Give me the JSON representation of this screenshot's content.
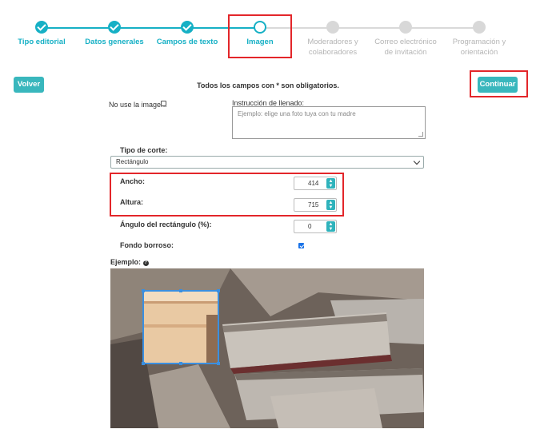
{
  "stepper": {
    "steps": [
      {
        "label": "Tipo editorial",
        "state": "done"
      },
      {
        "label": "Datos generales",
        "state": "done"
      },
      {
        "label": "Campos de texto",
        "state": "done"
      },
      {
        "label": "Imagen",
        "state": "current"
      },
      {
        "label": "Moderadores y colaboradores",
        "state": "todo"
      },
      {
        "label": "Correo electrónico de invitación",
        "state": "todo"
      },
      {
        "label": "Programación y orientación",
        "state": "todo"
      }
    ]
  },
  "toolbar": {
    "back_label": "Volver",
    "continue_label": "Continuar",
    "required_notice": "Todos los campos con * son obligatorios."
  },
  "form": {
    "no_image_label": "No use la imagen:",
    "no_image_checked": false,
    "instruction_label": "Instrucción de llenado:",
    "instruction_placeholder": "Ejemplo: elige una foto tuya con tu madre",
    "crop_type_label": "Tipo de corte:",
    "crop_type_value": "Rectángulo",
    "width_label": "Ancho:",
    "width_value": "414",
    "height_label": "Altura:",
    "height_value": "715",
    "angle_label": "Ángulo del rectángulo (%):",
    "angle_value": "0",
    "blur_label": "Fondo borroso:",
    "blur_checked": true,
    "example_label": "Ejemplo:"
  },
  "colors": {
    "accent": "#16b0c5",
    "button": "#39b7bd",
    "highlight": "#e3262a",
    "crop_border": "#3b8fe0"
  }
}
